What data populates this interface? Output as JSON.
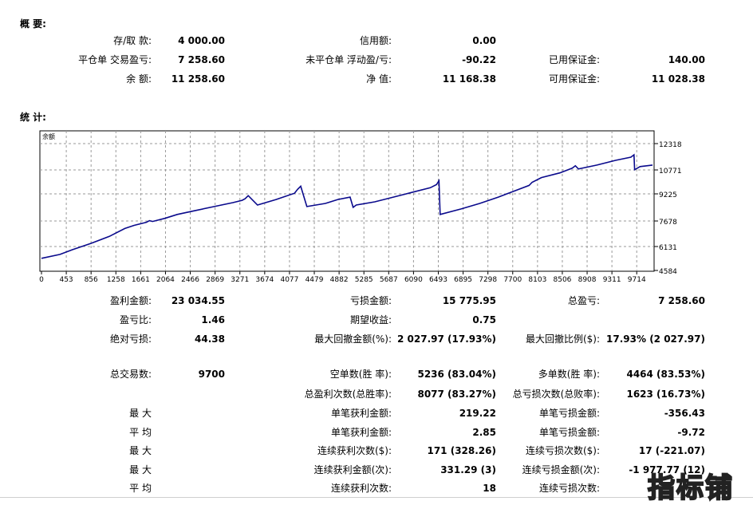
{
  "summary": {
    "title": "概 要:",
    "rows": [
      [
        {
          "label": "存/取 款:",
          "value": "4 000.00"
        },
        {
          "label": "信用额:",
          "value": "0.00"
        },
        null
      ],
      [
        {
          "label": "平仓单 交易盈亏:",
          "value": "7 258.60"
        },
        {
          "label": "未平仓单 浮动盈/亏:",
          "value": "-90.22"
        },
        {
          "label": "已用保证金:",
          "value": "140.00"
        }
      ],
      [
        {
          "label": "余 额:",
          "value": "11 258.60"
        },
        {
          "label": "净 值:",
          "value": "11 168.38"
        },
        {
          "label": "可用保证金:",
          "value": "11 028.38"
        }
      ]
    ]
  },
  "stats_title": "统 计:",
  "chart_data": {
    "type": "line",
    "title": "余额",
    "x_ticks": [
      "0",
      "453",
      "856",
      "1258",
      "1661",
      "2064",
      "2466",
      "2869",
      "3271",
      "3674",
      "4077",
      "4479",
      "4882",
      "5285",
      "5687",
      "6090",
      "6493",
      "6895",
      "7298",
      "7700",
      "8103",
      "8506",
      "8908",
      "9311",
      "9714"
    ],
    "y_ticks": [
      "12318",
      "10771",
      "9225",
      "7678",
      "6131",
      "4584"
    ],
    "ylim": [
      4584,
      12318
    ],
    "xlim": [
      0,
      9900
    ],
    "series": [
      {
        "x": [
          0,
          300,
          500,
          800,
          1100,
          1350,
          1500,
          1700,
          1750,
          1800,
          2000,
          2200,
          2500,
          2800,
          3100,
          3250,
          3300,
          3350,
          3500,
          3800,
          4100,
          4150,
          4200,
          4300,
          4600,
          4800,
          5000,
          5050,
          5100,
          5400,
          5700,
          6000,
          6300,
          6400,
          6440,
          6460,
          6800,
          7100,
          7400,
          7600,
          7900,
          7950,
          8100,
          8400,
          8600,
          8650,
          8700,
          9000,
          9300,
          9550,
          9600,
          9610,
          9700,
          9900
        ],
        "y": [
          4900,
          5150,
          5450,
          5850,
          6300,
          6800,
          7000,
          7200,
          7300,
          7250,
          7450,
          7700,
          7950,
          8200,
          8450,
          8600,
          8700,
          8900,
          8300,
          8650,
          9050,
          9300,
          9500,
          8200,
          8400,
          8650,
          8800,
          8150,
          8300,
          8500,
          8800,
          9100,
          9400,
          9600,
          9850,
          7700,
          8050,
          8400,
          8800,
          9100,
          9550,
          9750,
          10050,
          10350,
          10650,
          10800,
          10600,
          10850,
          11150,
          11350,
          11500,
          10550,
          10750,
          10850
        ]
      }
    ]
  },
  "stats": {
    "block1": [
      [
        {
          "label": "盈利金额:",
          "value": "23 034.55"
        },
        {
          "label": "亏损金额:",
          "value": "15 775.95"
        },
        {
          "label": "总盈亏:",
          "value": "7 258.60"
        }
      ],
      [
        {
          "label": "盈亏比:",
          "value": "1.46"
        },
        {
          "label": "期望收益:",
          "value": "0.75"
        },
        null
      ],
      [
        {
          "label": "绝对亏损:",
          "value": "44.38"
        },
        {
          "label": "最大回撤金额(%):",
          "value": "2 027.97 (17.93%)"
        },
        {
          "label": "最大回撤比例($):",
          "value": "17.93% (2 027.97)"
        }
      ]
    ],
    "block2": [
      [
        {
          "label": "总交易数:",
          "value": "9700"
        },
        {
          "label": "空单数(胜 率):",
          "value": "5236 (83.04%)"
        },
        {
          "label": "多单数(胜 率):",
          "value": "4464 (83.53%)"
        }
      ],
      [
        null,
        {
          "label": "总盈利次数(总胜率):",
          "value": "8077 (83.27%)"
        },
        {
          "label": "总亏损次数(总败率):",
          "value": "1623 (16.73%)"
        }
      ],
      [
        {
          "label": "最 大",
          "value": ""
        },
        {
          "label": "单笔获利金额:",
          "value": "219.22"
        },
        {
          "label": "单笔亏损金额:",
          "value": "-356.43"
        }
      ],
      [
        {
          "label": "平 均",
          "value": ""
        },
        {
          "label": "单笔获利金额:",
          "value": "2.85"
        },
        {
          "label": "单笔亏损金额:",
          "value": "-9.72"
        }
      ],
      [
        {
          "label": "最 大",
          "value": ""
        },
        {
          "label": "连续获利次数($):",
          "value": "171 (328.26)"
        },
        {
          "label": "连续亏损次数($):",
          "value": "17 (-221.07)"
        }
      ],
      [
        {
          "label": "最 大",
          "value": ""
        },
        {
          "label": "连续获利金额(次):",
          "value": "331.29 (3)"
        },
        {
          "label": "连续亏损金额(次):",
          "value": "-1 977.77 (12)"
        }
      ],
      [
        {
          "label": "平 均",
          "value": ""
        },
        {
          "label": "连续获利次数:",
          "value": "18"
        },
        {
          "label": "连续亏损次数:",
          "value": ""
        }
      ]
    ]
  },
  "watermark": "指标铺",
  "colors": {
    "line": "#0a0a8c",
    "grid": "#9a9a9a",
    "border": "#000000"
  }
}
